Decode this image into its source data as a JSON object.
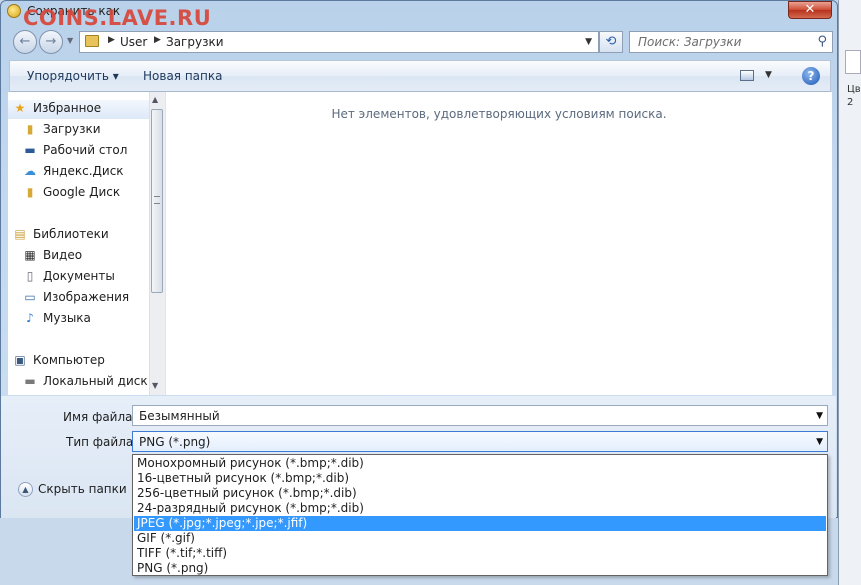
{
  "window": {
    "title": "Сохранить как",
    "watermark": "COINS.LAVE.RU",
    "close_glyph": "✕"
  },
  "navigation": {
    "back_glyph": "←",
    "forward_glyph": "→",
    "breadcrumb": [
      "User",
      "Загрузки"
    ],
    "refresh_glyph": "⟲",
    "search_placeholder": "Поиск: Загрузки"
  },
  "toolbar": {
    "organize_label": "Упорядочить ▾",
    "new_folder_label": "Новая папка",
    "help_glyph": "?"
  },
  "sidebar": {
    "items": [
      {
        "label": "Избранное",
        "icon": "star-icon",
        "glyph": "★",
        "color": "#e8a317"
      },
      {
        "label": "Загрузки",
        "icon": "downloads-folder-icon",
        "glyph": "▮",
        "color": "#d4a935"
      },
      {
        "label": "Рабочий стол",
        "icon": "desktop-icon",
        "glyph": "▬",
        "color": "#2d5b9a"
      },
      {
        "label": "Яндекс.Диск",
        "icon": "cloud-icon",
        "glyph": "☁",
        "color": "#3a8fd6"
      },
      {
        "label": "Google Диск",
        "icon": "google-drive-folder-icon",
        "glyph": "▮",
        "color": "#d4a935"
      },
      {
        "label": "Библиотеки",
        "icon": "libraries-icon",
        "glyph": "▤",
        "color": "#c9a13a"
      },
      {
        "label": "Видео",
        "icon": "video-icon",
        "glyph": "▦",
        "color": "#333"
      },
      {
        "label": "Документы",
        "icon": "documents-icon",
        "glyph": "▯",
        "color": "#667"
      },
      {
        "label": "Изображения",
        "icon": "pictures-icon",
        "glyph": "▭",
        "color": "#3b6ea5"
      },
      {
        "label": "Музыка",
        "icon": "music-icon",
        "glyph": "♪",
        "color": "#2d7bd1"
      },
      {
        "label": "Компьютер",
        "icon": "computer-icon",
        "glyph": "▣",
        "color": "#3a5a80"
      },
      {
        "label": "Локальный диск",
        "icon": "local-disk-icon",
        "glyph": "▬",
        "color": "#7a7a7a"
      }
    ]
  },
  "content": {
    "empty_message": "Нет элементов, удовлетворяющих условиям поиска."
  },
  "form": {
    "filename_label": "Имя файла:",
    "filename_value": "Безымянный",
    "filetype_label": "Тип файла:",
    "filetype_value": "PNG (*.png)",
    "hide_folders_label": "Скрыть папки"
  },
  "filetype_options": [
    {
      "label": "Монохромный рисунок (*.bmp;*.dib)",
      "selected": false
    },
    {
      "label": "16-цветный рисунок (*.bmp;*.dib)",
      "selected": false
    },
    {
      "label": "256-цветный рисунок (*.bmp;*.dib)",
      "selected": false
    },
    {
      "label": "24-разрядный рисунок (*.bmp;*.dib)",
      "selected": false
    },
    {
      "label": "JPEG (*.jpg;*.jpeg;*.jpe;*.jfif)",
      "selected": true
    },
    {
      "label": "GIF (*.gif)",
      "selected": false
    },
    {
      "label": "TIFF (*.tif;*.tiff)",
      "selected": false
    },
    {
      "label": "PNG (*.png)",
      "selected": false
    }
  ],
  "background": {
    "text_1": "Цве",
    "text_2": "2"
  }
}
